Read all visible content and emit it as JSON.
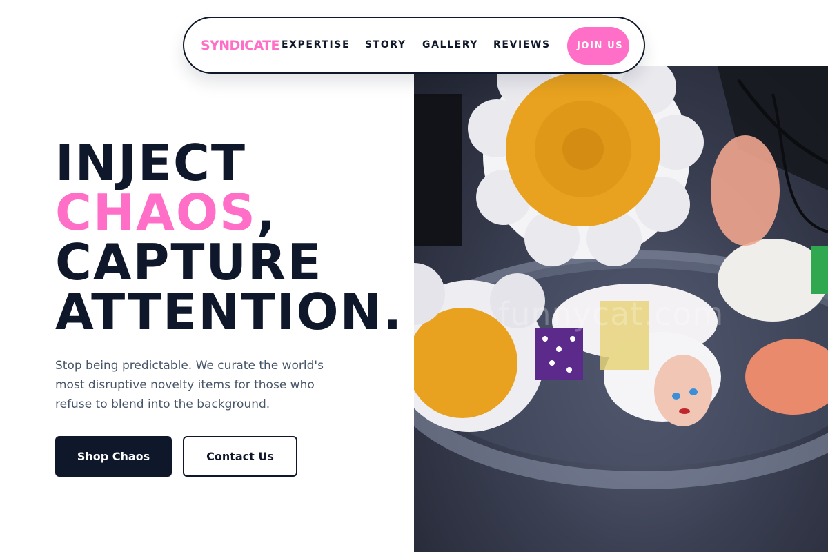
{
  "colors": {
    "accent": "#ff6ec7",
    "dark": "#0f172a",
    "muted": "#475569",
    "white": "#ffffff"
  },
  "nav": {
    "brand": "SYNDICATE",
    "items": [
      "EXPERTISE",
      "STORY",
      "GALLERY",
      "REVIEWS"
    ],
    "cta": "JOIN US"
  },
  "hero": {
    "line1": "INJECT",
    "line2_accent": "CHAOS",
    "line2_rest": ",",
    "line3": "CAPTURE",
    "line4": "ATTENTION.",
    "subtitle": "Stop being predictable. We curate the world's most disruptive novelty items for those who refuse to blend into the background.",
    "primary_button": "Shop Chaos",
    "secondary_button": "Contact Us"
  },
  "image": {
    "subject": "crocheted daisy keychains and a doll keychain in a plastic bowl",
    "watermark": "funnycat.com"
  }
}
